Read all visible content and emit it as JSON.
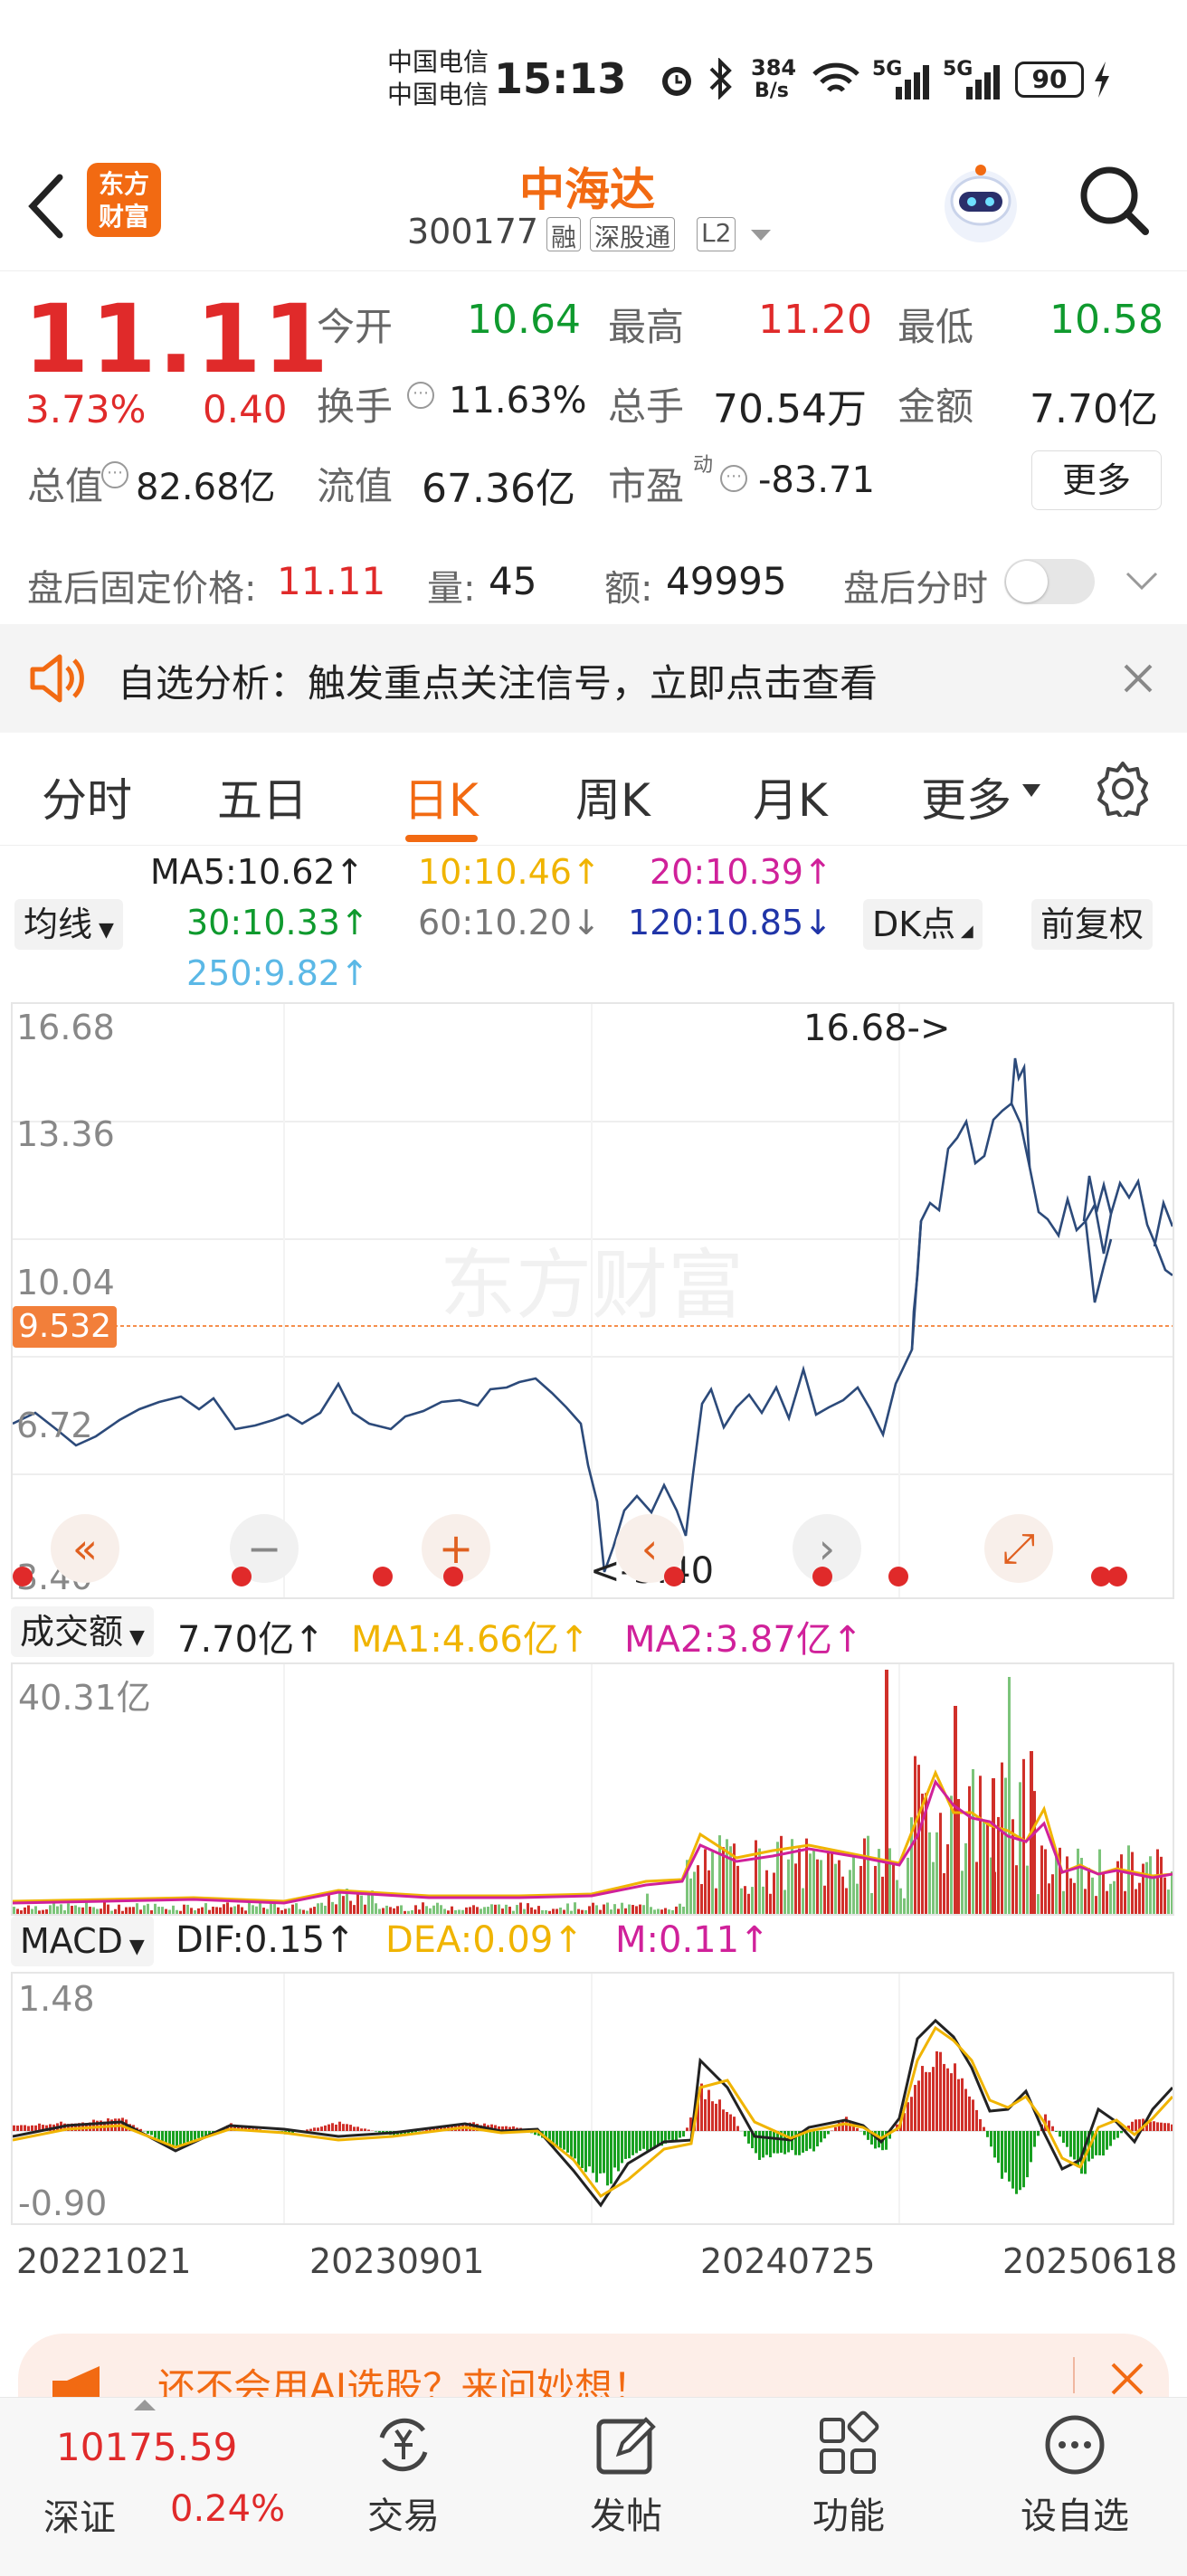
{
  "status_bar": {
    "carrier1": "中国电信",
    "carrier2": "中国电信",
    "time": "15:13",
    "net_speed_top": "384",
    "net_speed_bottom": "B/s",
    "battery": "90",
    "signal_a": "5G",
    "signal_b": "5G"
  },
  "header": {
    "title": "中海达",
    "code": "300177",
    "tags": [
      "融",
      "深股通",
      "L2"
    ],
    "logo_line1": "东方",
    "logo_line2": "财富"
  },
  "quote": {
    "price": "11.11",
    "change_pct": "3.73%",
    "change": "0.40",
    "open_label": "今开",
    "open": "10.64",
    "high_label": "最高",
    "high": "11.20",
    "low_label": "最低",
    "low": "10.58",
    "turnover_label": "换手",
    "turnover": "11.63%",
    "volume_label": "总手",
    "volume": "70.54万",
    "amount_label": "金额",
    "amount": "7.70亿",
    "mktcap_label": "总值",
    "mktcap": "82.68亿",
    "float_label": "流值",
    "float": "67.36亿",
    "pe_label": "市盈",
    "pe_sup": "动",
    "pe": "-83.71",
    "more": "更多"
  },
  "after_hours": {
    "price_label": "盘后固定价格:",
    "price": "11.11",
    "vol_label": "量:",
    "vol": "45",
    "amt_label": "额:",
    "amt": "49995",
    "toggle_label": "盘后分时"
  },
  "alert": {
    "text": "自选分析：触发重点关注信号，立即点击查看"
  },
  "tabs": [
    "分时",
    "五日",
    "日K",
    "周K",
    "月K",
    "更多"
  ],
  "active_tab": "日K",
  "ma": {
    "selector": "均线",
    "dk": "DK点",
    "adjust": "前复权",
    "ma5": "MA5:10.62↑",
    "ma10": "10:10.46↑",
    "ma20": "20:10.39↑",
    "ma30": "30:10.33↑",
    "ma60": "60:10.20↓",
    "ma120": "120:10.85↓",
    "ma250": "250:9.82↑"
  },
  "price_chart": {
    "y_labels": [
      "16.68",
      "13.36",
      "10.04",
      "6.72",
      "3.40"
    ],
    "current_marker": "9.532",
    "high_note": "16.68->",
    "low_note": "<-3.40",
    "watermark": "东方财富"
  },
  "volume_chart": {
    "selector": "成交额",
    "value": "7.70亿↑",
    "ma1": "MA1:4.66亿↑",
    "ma2": "MA2:3.87亿↑",
    "max_label": "40.31亿"
  },
  "macd_chart": {
    "selector": "MACD",
    "dif": "DIF:0.15↑",
    "dea": "DEA:0.09↑",
    "m": "M:0.11↑",
    "max_label": "1.48",
    "min_label": "-0.90"
  },
  "x_axis": [
    "20221021",
    "20230901",
    "20240725",
    "20250618"
  ],
  "promo": {
    "text": "还不会用AI选股？来问妙想！"
  },
  "bottom_nav": {
    "index_value": "10175.59",
    "index_name": "深证",
    "index_change": "0.24%",
    "items": [
      "交易",
      "发帖",
      "功能",
      "设自选"
    ]
  },
  "colors": {
    "up": "#e02a2a",
    "down": "#0f9a2e",
    "accent": "#f26a12",
    "ma5": "#222222",
    "ma10": "#f0b400",
    "ma20": "#d0219a",
    "ma30": "#0f9a2e",
    "ma60": "#777777",
    "ma120": "#2035a8",
    "ma250": "#5bb8e6",
    "price_line": "#2c4a7a"
  },
  "chart_data": {
    "type": "line",
    "x": [
      "20221021",
      "20230901",
      "20240725",
      "20250618"
    ],
    "series": [
      {
        "values": [
          6.5,
          7.5,
          4.0,
          6.0,
          8.5,
          15.5,
          9.5,
          12.5,
          10.5,
          11.1
        ]
      }
    ],
    "ylim": [
      3.4,
      16.68
    ]
  }
}
